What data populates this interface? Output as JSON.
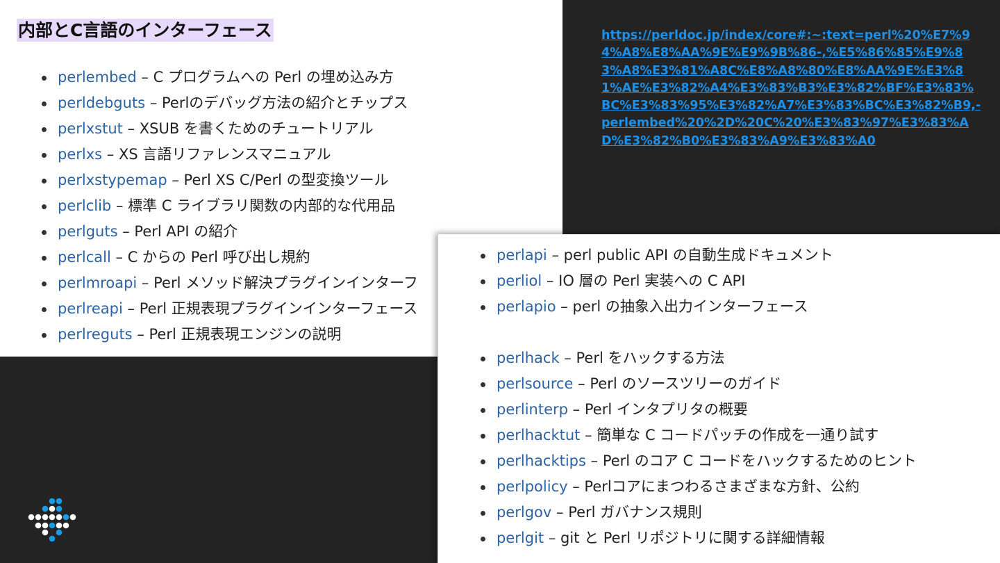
{
  "section_heading": "内部とC言語のインターフェース",
  "url": "https://perldoc.jp/index/core#:~:text=perl%20%E7%94%A8%E8%AA%9E%E9%9B%86-,%E5%86%85%E9%83%A8%E3%81%A8C%E8%A8%80%E8%AA%9E%E3%81%AE%E3%82%A4%E3%83%B3%E3%82%BF%E3%83%BC%E3%83%95%E3%82%A7%E3%83%BC%E3%82%B9,-perlembed%20%2D%20C%20%E3%83%97%E3%83%AD%E3%82%B0%E3%83%A9%E3%83%A0",
  "separator": "–",
  "left_list": [
    {
      "name": "perlembed",
      "desc": "C プログラムへの Perl の埋め込み方"
    },
    {
      "name": "perldebguts",
      "desc": "Perlのデバッグ方法の紹介とチップス"
    },
    {
      "name": "perlxstut",
      "desc": "XSUB を書くためのチュートリアル"
    },
    {
      "name": "perlxs",
      "desc": "XS 言語リファレンスマニュアル"
    },
    {
      "name": "perlxstypemap",
      "desc": "Perl XS C/Perl の型変換ツール"
    },
    {
      "name": "perlclib",
      "desc": "標準 C ライブラリ関数の内部的な代用品"
    },
    {
      "name": "perlguts",
      "desc": "Perl API の紹介"
    },
    {
      "name": "perlcall",
      "desc": "C からの Perl 呼び出し規約"
    },
    {
      "name": "perlmroapi",
      "desc": "Perl メソッド解決プラグインインターフ"
    },
    {
      "name": "perlreapi",
      "desc": "Perl 正規表現プラグインインターフェース"
    },
    {
      "name": "perlreguts",
      "desc": "Perl 正規表現エンジンの説明"
    }
  ],
  "right_list_a": [
    {
      "name": "perlapi",
      "desc": "perl public API の自動生成ドキュメント"
    },
    {
      "name": "perliol",
      "desc": "IO 層の Perl 実装への C API"
    },
    {
      "name": "perlapio",
      "desc": "perl の抽象入出力インターフェース"
    }
  ],
  "right_list_b": [
    {
      "name": "perlhack",
      "desc": "Perl をハックする方法"
    },
    {
      "name": "perlsource",
      "desc": "Perl のソースツリーのガイド"
    },
    {
      "name": "perlinterp",
      "desc": "Perl インタプリタの概要"
    },
    {
      "name": "perlhacktut",
      "desc": "簡単な C コードパッチの作成を一通り試す"
    },
    {
      "name": "perlhacktips",
      "desc": "Perl のコア C コードをハックするためのヒント"
    },
    {
      "name": "perlpolicy",
      "desc": "Perlコアにまつわるさまざまな方針、公約"
    },
    {
      "name": "perlgov",
      "desc": "Perl ガバナンス規則"
    },
    {
      "name": "perlgit",
      "desc": "git と Perl リポジトリに関する詳細情報"
    }
  ],
  "colors": {
    "link": "#2d62a3",
    "url": "#1d8fe6",
    "heading_highlight": "#e6d9fb",
    "background_dark": "#232323",
    "logo_blue": "#1a9be6",
    "logo_white": "#ffffff"
  },
  "logo_icon": "dot-grid-logo-icon"
}
